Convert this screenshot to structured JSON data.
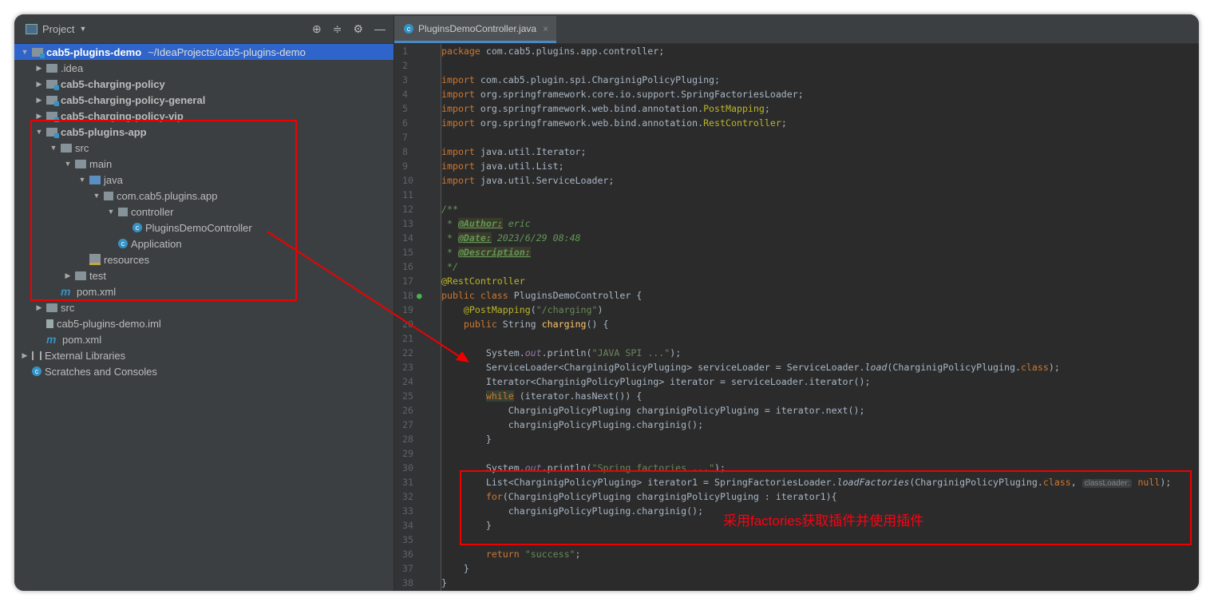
{
  "project_panel": {
    "title": "Project",
    "tools": [
      "locate-icon",
      "collapse-icon",
      "gear-icon",
      "minimize-icon"
    ],
    "tree": [
      {
        "label": "cab5-plugins-demo",
        "extra": "~/IdeaProjects/cab5-plugins-demo",
        "depth": 0,
        "icon": "module",
        "arrow": "down",
        "bold": true,
        "selected": true
      },
      {
        "label": ".idea",
        "depth": 1,
        "icon": "folder",
        "arrow": "right"
      },
      {
        "label": "cab5-charging-policy",
        "depth": 1,
        "icon": "module",
        "arrow": "right",
        "bold": true
      },
      {
        "label": "cab5-charging-policy-general",
        "depth": 1,
        "icon": "module",
        "arrow": "right",
        "bold": true
      },
      {
        "label": "cab5-charging-policy-vip",
        "depth": 1,
        "icon": "module",
        "arrow": "right",
        "bold": true
      },
      {
        "label": "cab5-plugins-app",
        "depth": 1,
        "icon": "module",
        "arrow": "down",
        "bold": true
      },
      {
        "label": "src",
        "depth": 2,
        "icon": "folder",
        "arrow": "down"
      },
      {
        "label": "main",
        "depth": 3,
        "icon": "folder",
        "arrow": "down"
      },
      {
        "label": "java",
        "depth": 4,
        "icon": "src",
        "arrow": "down"
      },
      {
        "label": "com.cab5.plugins.app",
        "depth": 5,
        "icon": "pkg",
        "arrow": "down"
      },
      {
        "label": "controller",
        "depth": 6,
        "icon": "pkg",
        "arrow": "down"
      },
      {
        "label": "PluginsDemoController",
        "depth": 7,
        "icon": "cls",
        "arrow": ""
      },
      {
        "label": "Application",
        "depth": 6,
        "icon": "cls",
        "arrow": ""
      },
      {
        "label": "resources",
        "depth": 4,
        "icon": "res",
        "arrow": ""
      },
      {
        "label": "test",
        "depth": 3,
        "icon": "folder",
        "arrow": "right"
      },
      {
        "label": "pom.xml",
        "depth": 2,
        "icon": "m",
        "arrow": ""
      },
      {
        "label": "src",
        "depth": 1,
        "icon": "folder",
        "arrow": "right"
      },
      {
        "label": "cab5-plugins-demo.iml",
        "depth": 1,
        "icon": "file",
        "arrow": ""
      },
      {
        "label": "pom.xml",
        "depth": 1,
        "icon": "m",
        "arrow": ""
      },
      {
        "label": "External Libraries",
        "depth": 0,
        "icon": "lib",
        "arrow": "right"
      },
      {
        "label": "Scratches and Consoles",
        "depth": 0,
        "icon": "cls",
        "arrow": ""
      }
    ]
  },
  "editor": {
    "tab": "PluginsDemoController.java",
    "lines": [
      [
        [
          "package ",
          "k"
        ],
        [
          "com.cab5.plugins.app.controller;",
          ""
        ]
      ],
      [],
      [
        [
          "import ",
          "k"
        ],
        [
          "com.cab5.plugin.spi.CharginigPolicyPluging;",
          ""
        ]
      ],
      [
        [
          "import ",
          "k"
        ],
        [
          "org.springframework.core.io.support.SpringFactoriesLoader;",
          ""
        ]
      ],
      [
        [
          "import ",
          "k"
        ],
        [
          "org.springframework.web.bind.annotation.",
          ""
        ],
        [
          "PostMapping",
          "a"
        ],
        [
          ";",
          ""
        ]
      ],
      [
        [
          "import ",
          "k"
        ],
        [
          "org.springframework.web.bind.annotation.",
          ""
        ],
        [
          "RestController",
          "a"
        ],
        [
          ";",
          ""
        ]
      ],
      [],
      [
        [
          "import ",
          "k"
        ],
        [
          "java.util.Iterator;",
          ""
        ]
      ],
      [
        [
          "import ",
          "k"
        ],
        [
          "java.util.List;",
          ""
        ]
      ],
      [
        [
          "import ",
          "k"
        ],
        [
          "java.util.ServiceLoader;",
          ""
        ]
      ],
      [],
      [
        [
          "/**",
          "c"
        ]
      ],
      [
        [
          " * ",
          "c"
        ],
        [
          "@Author:",
          "ct"
        ],
        [
          " eric",
          "c"
        ]
      ],
      [
        [
          " * ",
          "c"
        ],
        [
          "@Date:",
          "ct"
        ],
        [
          " 2023/6/29 08:48",
          "c"
        ]
      ],
      [
        [
          " * ",
          "c"
        ],
        [
          "@Description:",
          "ct"
        ]
      ],
      [
        [
          " */",
          "c"
        ]
      ],
      [
        [
          "@RestController",
          "a"
        ]
      ],
      [
        [
          "public class ",
          "k"
        ],
        [
          "PluginsDemoController {",
          ""
        ]
      ],
      [
        [
          "    @PostMapping",
          "a"
        ],
        [
          "(",
          ""
        ],
        [
          "\"/charging\"",
          "s"
        ],
        [
          ")",
          ""
        ]
      ],
      [
        [
          "    public ",
          "k"
        ],
        [
          "String ",
          ""
        ],
        [
          "charging",
          "m2"
        ],
        [
          "() {",
          ""
        ]
      ],
      [],
      [
        [
          "        System.",
          ""
        ],
        [
          "out",
          "f"
        ],
        [
          ".println(",
          ""
        ],
        [
          "\"JAVA SPI ...\"",
          "s"
        ],
        [
          ");",
          ""
        ]
      ],
      [
        [
          "        ServiceLoader<CharginigPolicyPluging> serviceLoader = ServiceLoader.",
          ""
        ],
        [
          "load",
          "i"
        ],
        [
          "(CharginigPolicyPluging.",
          ""
        ],
        [
          "class",
          "k"
        ],
        [
          ");",
          ""
        ]
      ],
      [
        [
          "        Iterator<CharginigPolicyPluging> iterator = serviceLoader.iterator();",
          ""
        ]
      ],
      [
        [
          "        ",
          ""
        ],
        [
          "while",
          "k h"
        ],
        [
          " (iterator.hasNext()) {",
          ""
        ]
      ],
      [
        [
          "            CharginigPolicyPluging charginigPolicyPluging = iterator.next();",
          ""
        ]
      ],
      [
        [
          "            charginigPolicyPluging.charginig();",
          ""
        ]
      ],
      [
        [
          "        }",
          ""
        ]
      ],
      [],
      [
        [
          "        System.",
          ""
        ],
        [
          "out",
          "f"
        ],
        [
          ".println(",
          ""
        ],
        [
          "\"Spring factories ...\"",
          "s"
        ],
        [
          ");",
          ""
        ]
      ],
      [
        [
          "        List<CharginigPolicyPluging> iterator1 = SpringFactoriesLoader.",
          ""
        ],
        [
          "loadFactories",
          "i"
        ],
        [
          "(CharginigPolicyPluging.",
          ""
        ],
        [
          "class",
          "k"
        ],
        [
          ", ",
          ""
        ],
        [
          "classLoader:",
          "hint"
        ],
        [
          " ",
          ""
        ],
        [
          "null",
          "k"
        ],
        [
          ");",
          ""
        ]
      ],
      [
        [
          "        ",
          ""
        ],
        [
          "for",
          "k"
        ],
        [
          "(CharginigPolicyPluging charginigPolicyPluging : iterator1){",
          ""
        ]
      ],
      [
        [
          "            charginigPolicyPluging.charginig();",
          ""
        ]
      ],
      [
        [
          "        }",
          ""
        ]
      ],
      [],
      [
        [
          "        ",
          ""
        ],
        [
          "return ",
          "k"
        ],
        [
          "\"success\"",
          "s"
        ],
        [
          ";",
          ""
        ]
      ],
      [
        [
          "    }",
          ""
        ]
      ],
      [
        [
          "}",
          ""
        ]
      ]
    ]
  },
  "annotation": {
    "text": "采用factories获取插件并使用插件",
    "color": "#ff0011"
  }
}
